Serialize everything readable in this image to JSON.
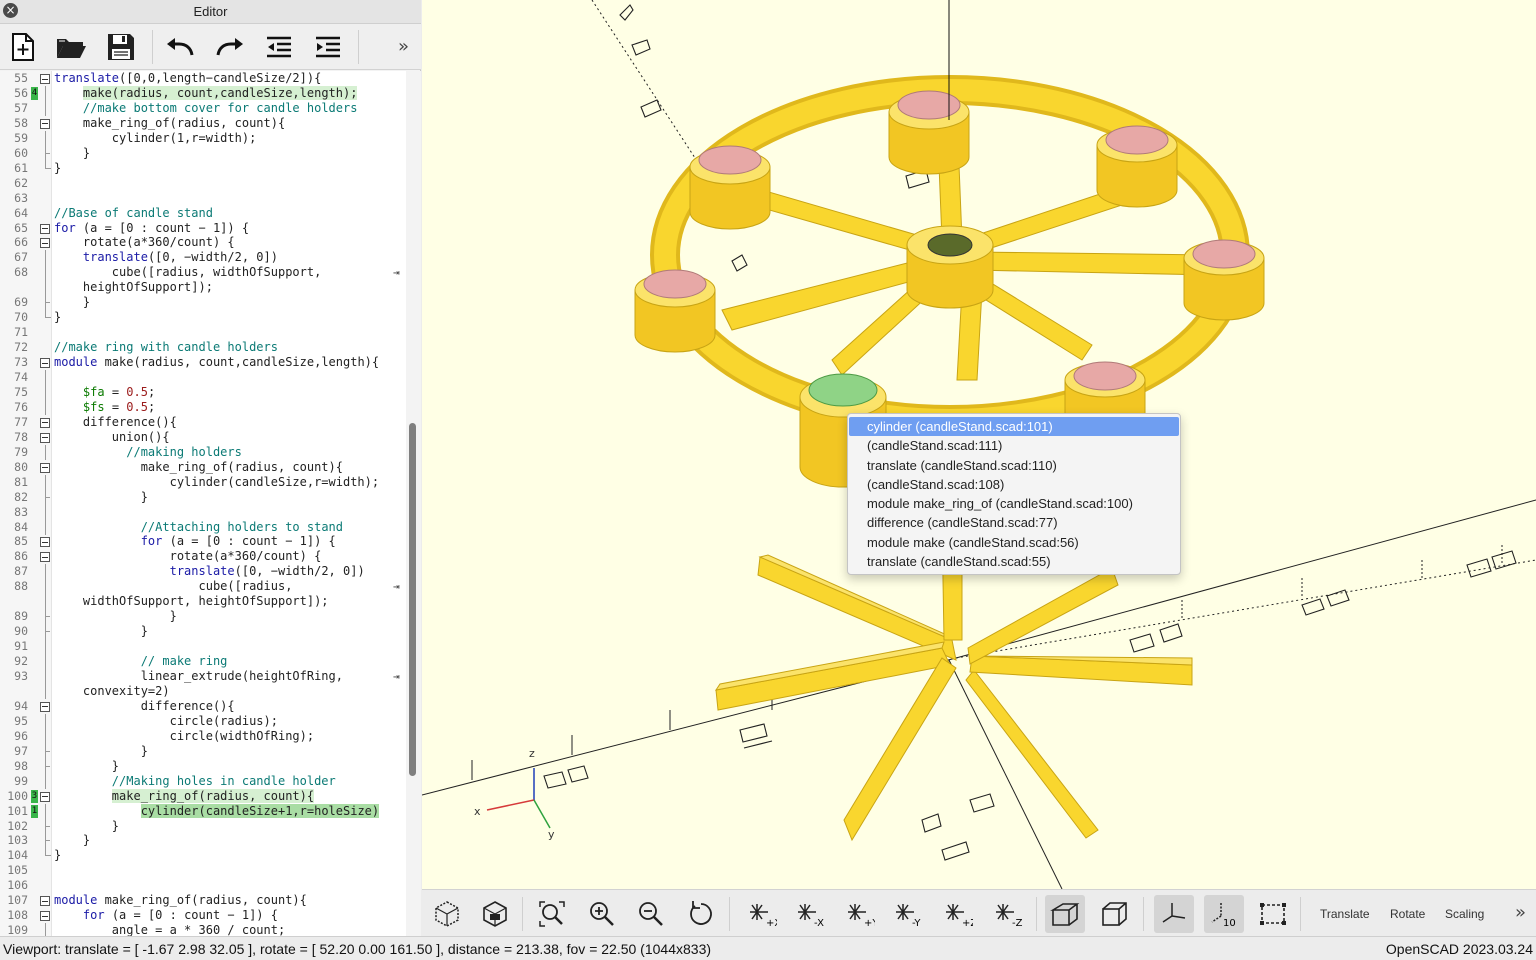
{
  "editor": {
    "title": "Editor",
    "close_icon": "close-icon",
    "toolbar": [
      "new-file-icon",
      "open-file-icon",
      "save-file-icon",
      "undo-icon",
      "redo-icon",
      "unindent-icon",
      "indent-icon"
    ],
    "more": "»"
  },
  "code_lines": [
    {
      "n": "55",
      "html": "<span class='kw'>translate</span>([0,0,length&minus;candleSize/2]){",
      "fold": "box"
    },
    {
      "n": "56",
      "html": "    <span class='hl'>make(radius, count,candleSize,length);</span>",
      "fold": "line",
      "mark": "4"
    },
    {
      "n": "57",
      "html": "    <span class='cm'>//make bottom cover for candle holders</span>",
      "fold": "line"
    },
    {
      "n": "58",
      "html": "    make_ring_of(radius, count){",
      "fold": "box"
    },
    {
      "n": "59",
      "html": "        cylinder(1,r=width);",
      "fold": "line"
    },
    {
      "n": "60",
      "html": "    }",
      "fold": "mid"
    },
    {
      "n": "61",
      "html": "}",
      "fold": "end"
    },
    {
      "n": "62",
      "html": ""
    },
    {
      "n": "63",
      "html": ""
    },
    {
      "n": "64",
      "html": "<span class='cm'>//Base of candle stand</span>"
    },
    {
      "n": "65",
      "html": "<span class='kw'>for</span> (a = [0 : count &minus; 1]) {",
      "fold": "box"
    },
    {
      "n": "66",
      "html": "    rotate(a*360/count) {",
      "fold": "box"
    },
    {
      "n": "67",
      "html": "    <span class='kw'>translate</span>([0, &minus;width/2, 0])",
      "fold": "line"
    },
    {
      "n": "68",
      "html": "        cube([radius, widthOfSupport,",
      "fold": "line",
      "wrap": true
    },
    {
      "n": "",
      "html": "    heightOfSupport]);",
      "fold": "line"
    },
    {
      "n": "69",
      "html": "    }",
      "fold": "mid"
    },
    {
      "n": "70",
      "html": "}",
      "fold": "end"
    },
    {
      "n": "71",
      "html": ""
    },
    {
      "n": "72",
      "html": "<span class='cm'>//make ring with candle holders</span>"
    },
    {
      "n": "73",
      "html": "<span class='kw'>module</span> make(radius, count,candleSize,length){",
      "fold": "box"
    },
    {
      "n": "74",
      "html": "",
      "fold": "line"
    },
    {
      "n": "75",
      "html": "    <span class='var'>$fa</span> = <span class='num'>0.5</span>;",
      "fold": "line"
    },
    {
      "n": "76",
      "html": "    <span class='var'>$fs</span> = <span class='num'>0.5</span>;",
      "fold": "line"
    },
    {
      "n": "77",
      "html": "    difference(){",
      "fold": "box"
    },
    {
      "n": "78",
      "html": "        union(){",
      "fold": "box"
    },
    {
      "n": "79",
      "html": "          <span class='cm'>//making holders</span>",
      "fold": "line"
    },
    {
      "n": "80",
      "html": "            make_ring_of(radius, count){",
      "fold": "box"
    },
    {
      "n": "81",
      "html": "                cylinder(candleSize,r=width);",
      "fold": "line"
    },
    {
      "n": "82",
      "html": "            }",
      "fold": "mid"
    },
    {
      "n": "83",
      "html": "",
      "fold": "line"
    },
    {
      "n": "84",
      "html": "            <span class='cm'>//Attaching holders to stand</span>",
      "fold": "line"
    },
    {
      "n": "85",
      "html": "            <span class='kw'>for</span> (a = [0 : count &minus; 1]) {",
      "fold": "box"
    },
    {
      "n": "86",
      "html": "                rotate(a*360/count) {",
      "fold": "box"
    },
    {
      "n": "87",
      "html": "                <span class='kw'>translate</span>([0, &minus;width/2, 0])",
      "fold": "line"
    },
    {
      "n": "88",
      "html": "                    cube([radius,",
      "fold": "line",
      "wrap": true
    },
    {
      "n": "",
      "html": "    widthOfSupport, heightOfSupport]);",
      "fold": "line"
    },
    {
      "n": "89",
      "html": "                }",
      "fold": "mid"
    },
    {
      "n": "90",
      "html": "            }",
      "fold": "mid"
    },
    {
      "n": "91",
      "html": "",
      "fold": "line"
    },
    {
      "n": "92",
      "html": "            <span class='cm'>// make ring</span>",
      "fold": "line"
    },
    {
      "n": "93",
      "html": "            linear_extrude(heightOfRing,",
      "fold": "line",
      "wrap": true
    },
    {
      "n": "",
      "html": "    convexity=2)",
      "fold": "line"
    },
    {
      "n": "94",
      "html": "            difference(){",
      "fold": "box"
    },
    {
      "n": "95",
      "html": "                circle(radius);",
      "fold": "line"
    },
    {
      "n": "96",
      "html": "                circle(widthOfRing);",
      "fold": "line"
    },
    {
      "n": "97",
      "html": "            }",
      "fold": "mid"
    },
    {
      "n": "98",
      "html": "        }",
      "fold": "mid"
    },
    {
      "n": "99",
      "html": "        <span class='cm'>//Making holes in candle holder</span>",
      "fold": "line"
    },
    {
      "n": "100",
      "html": "        <span class='hl'>make_ring_of(radius, count){</span>",
      "fold": "box",
      "mark": "3"
    },
    {
      "n": "101",
      "html": "            <span class='hl2'>cylinder(candleSize+1,r=holeSize)</span>",
      "fold": "line",
      "mark": "1"
    },
    {
      "n": "102",
      "html": "        }",
      "fold": "mid"
    },
    {
      "n": "103",
      "html": "    }",
      "fold": "mid"
    },
    {
      "n": "104",
      "html": "}",
      "fold": "end"
    },
    {
      "n": "105",
      "html": ""
    },
    {
      "n": "106",
      "html": ""
    },
    {
      "n": "107",
      "html": "<span class='kw'>module</span> make_ring_of(radius, count){",
      "fold": "box"
    },
    {
      "n": "108",
      "html": "    <span class='kw'>for</span> (a = [0 : count &minus; 1]) {",
      "fold": "box"
    },
    {
      "n": "109",
      "html": "        angle = a * 360 / count;",
      "fold": "line"
    }
  ],
  "context_menu": {
    "items": [
      {
        "label": "cylinder (candleStand.scad:101)",
        "selected": true
      },
      {
        "label": " (candleStand.scad:111)"
      },
      {
        "label": "translate (candleStand.scad:110)"
      },
      {
        "label": " (candleStand.scad:108)"
      },
      {
        "label": "module make_ring_of (candleStand.scad:100)"
      },
      {
        "label": "difference (candleStand.scad:77)"
      },
      {
        "label": "module make (candleStand.scad:56)"
      },
      {
        "label": "translate (candleStand.scad:55)"
      }
    ]
  },
  "viewport": {
    "background": "#ffffe5",
    "model_color": "#f9d62e",
    "axis_labels": {
      "x": "x",
      "y": "y",
      "z": "z"
    },
    "toolbar_icons": [
      "preview-icon",
      "render-icon",
      "view-all-icon",
      "zoom-in-icon",
      "zoom-out-icon",
      "reset-view-icon",
      "view-right-icon",
      "view-left-icon",
      "view-back-icon",
      "view-front-icon",
      "view-top-icon",
      "view-bottom-icon",
      "perspective-icon",
      "orthogonal-icon",
      "show-axes-icon",
      "show-scale-markers-icon",
      "show-edges-icon"
    ],
    "toolbar_labels": {
      "translate": "Translate",
      "rotate": "Rotate",
      "scaling": "Scaling"
    },
    "more": "»"
  },
  "status": {
    "viewport": "Viewport: translate = [ -1.67 2.98 32.05 ], rotate = [ 52.20 0.00 161.50 ], distance = 213.38, fov = 22.50 (1044x833)",
    "version": "OpenSCAD 2023.03.24"
  }
}
